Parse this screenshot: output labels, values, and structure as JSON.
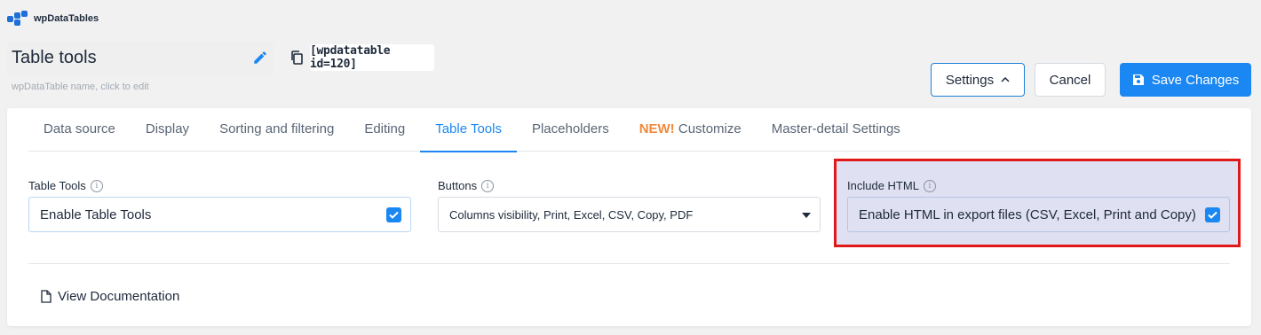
{
  "app": {
    "logo_text": "wpDataTables"
  },
  "header": {
    "table_name": "Table tools",
    "name_hint": "wpDataTable name, click to edit",
    "shortcode": "[wpdatatable id=120]",
    "settings_label": "Settings",
    "cancel_label": "Cancel",
    "save_label": "Save Changes"
  },
  "tabs": [
    {
      "label": "Data source"
    },
    {
      "label": "Display"
    },
    {
      "label": "Sorting and filtering"
    },
    {
      "label": "Editing"
    },
    {
      "label": "Table Tools",
      "active": true
    },
    {
      "label": "Placeholders"
    },
    {
      "badge": "NEW!",
      "label": "Customize"
    },
    {
      "label": "Master-detail Settings"
    }
  ],
  "fields": {
    "table_tools": {
      "label": "Table Tools",
      "value": "Enable Table Tools",
      "checked": true
    },
    "buttons": {
      "label": "Buttons",
      "value": "Columns visibility, Print, Excel, CSV, Copy, PDF"
    },
    "include_html": {
      "label": "Include HTML",
      "value": "Enable HTML in export files (CSV, Excel, Print and Copy)",
      "checked": true
    }
  },
  "footer": {
    "doc_link": "View Documentation"
  },
  "colors": {
    "accent": "#1a87f2",
    "highlight_border": "#e01818",
    "new_badge": "#f08a3c"
  },
  "icons": [
    "pencil-icon",
    "copy-icon",
    "chevron-up-icon",
    "save-icon",
    "info-icon",
    "checkbox-icon",
    "caret-down-icon",
    "document-icon"
  ]
}
